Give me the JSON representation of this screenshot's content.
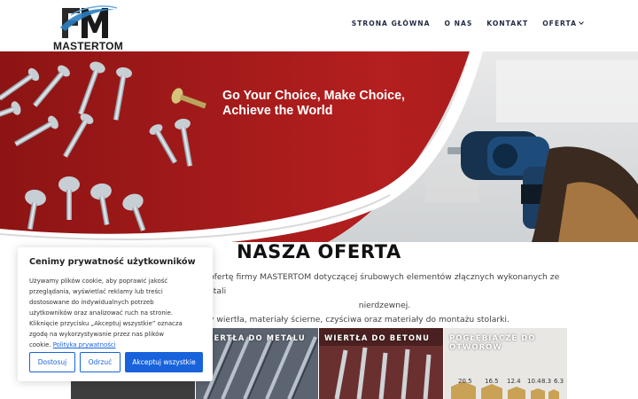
{
  "brand": {
    "logo_letters": "FM",
    "logo_name": "MASTERTOM"
  },
  "nav": {
    "items": [
      {
        "label": "STRONA GŁÓWNA"
      },
      {
        "label": "O NAS"
      },
      {
        "label": "KONTAKT"
      },
      {
        "label": "OFERTA"
      }
    ]
  },
  "hero": {
    "line1": "Go Your Choice, Make Choice,",
    "line2": "Achieve the World"
  },
  "offer": {
    "title": "NASZA OFERTA",
    "desc_line1": "ofertę firmy MASTERTOM dotyczącej śrubowych elementów złącznych wykonanych ze stali",
    "desc_line2": "nierdzewnej.",
    "desc_line3": "y wiertła, materiały ścierne, czyściwa oraz materiały do montażu stolarki."
  },
  "tiles": [
    {
      "label": "WIERTŁA DO METALU"
    },
    {
      "label": "WIERTŁA DO BETONU"
    },
    {
      "label": "POGŁĘBIACZE DO OTWORÓW"
    }
  ],
  "drill_sizes": [
    "20.5",
    "16.5",
    "12.4",
    "10.4",
    "8.3",
    "6.3"
  ],
  "cookie": {
    "title": "Cenimy prywatność użytkowników",
    "body_l1": "Używamy plików cookie, aby poprawić jakość",
    "body_l2": "przeglądania, wyświetlać reklamy lub treści",
    "body_l3": "dostosowane do indywidualnych potrzeb",
    "body_l4": "użytkowników oraz analizować ruch na stronie.",
    "body_l5": "Kliknięcie przycisku „Akceptuj wszystkie” oznacza",
    "body_l6": "zgodę na wykorzystywanie przez nas plików",
    "body_l7": "cookie.",
    "policy_link": "Polityka prywatności",
    "customize": "Dostosuj",
    "reject": "Odrzuć",
    "accept": "Akceptuj wszystkie"
  },
  "colors": {
    "accent": "#1863dc",
    "hero_red": "#b01e1e",
    "nav_text": "#1f2a44"
  }
}
